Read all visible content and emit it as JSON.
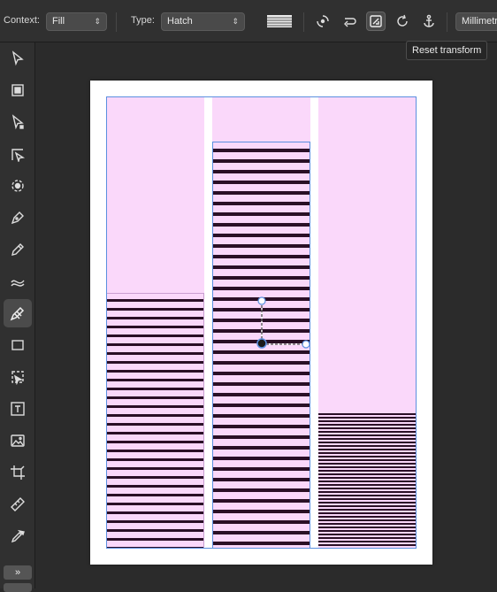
{
  "context_toolbar": {
    "context_label": "Context:",
    "context_value": "Fill",
    "type_label": "Type:",
    "type_value": "Hatch",
    "units_value": "Millimetres",
    "icons": [
      "hatch-pattern-icon",
      "transform-icon",
      "swap-icon",
      "reset-transform-icon",
      "rotate-icon",
      "anchor-icon"
    ]
  },
  "tooltip": {
    "text": "Reset transform"
  },
  "tools": {
    "items": [
      "move-tool",
      "artboard-tool",
      "node-tool",
      "corner-tool",
      "point-transform-tool",
      "pen-tool",
      "pencil-tool",
      "vector-brush-tool",
      "fill-tool",
      "rectangle-tool",
      "shape-tool",
      "frame-text-tool",
      "place-image-tool",
      "crop-tool",
      "measure-tool",
      "color-picker-tool"
    ],
    "active": "fill-tool",
    "more_label": "»"
  },
  "colors": {
    "pink": "#fad8fa",
    "hatch": "#2a0f26",
    "selection": "#5b8fdf"
  }
}
